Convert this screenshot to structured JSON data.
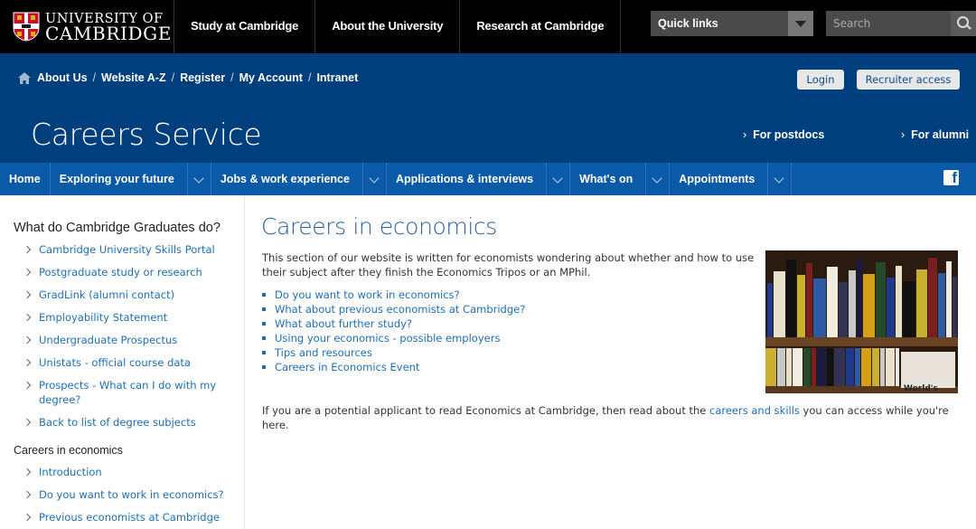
{
  "brand": {
    "line1": "UNIVERSITY OF",
    "line2": "CAMBRIDGE"
  },
  "topnav": [
    {
      "label": "Study at Cambridge"
    },
    {
      "label": "About the University"
    },
    {
      "label": "Research at Cambridge"
    }
  ],
  "quick_links": {
    "label": "Quick links"
  },
  "search": {
    "placeholder": "Search"
  },
  "breadcrumb": [
    {
      "label": "About Us"
    },
    {
      "label": "Website A-Z"
    },
    {
      "label": "Register"
    },
    {
      "label": "My Account"
    },
    {
      "label": "Intranet"
    }
  ],
  "header_buttons": {
    "login": "Login",
    "recruiter": "Recruiter access"
  },
  "site_title": "Careers Service",
  "header_links": {
    "postdocs": "For postdocs",
    "alumni": "For alumni"
  },
  "mainnav": [
    {
      "label": "Home",
      "dropdown": false
    },
    {
      "label": "Exploring your future",
      "dropdown": true
    },
    {
      "label": "Jobs & work experience",
      "dropdown": true
    },
    {
      "label": "Applications & interviews",
      "dropdown": true
    },
    {
      "label": "What's on",
      "dropdown": true
    },
    {
      "label": "Appointments",
      "dropdown": true
    }
  ],
  "sidebar": {
    "title": "What do Cambridge Graduates do?",
    "items": [
      {
        "label": "Cambridge University Skills Portal"
      },
      {
        "label": "Postgraduate study or research"
      },
      {
        "label": "GradLink (alumni contact)"
      },
      {
        "label": "Employability Statement"
      },
      {
        "label": "Undergraduate Prospectus"
      },
      {
        "label": "Unistats - official course data"
      },
      {
        "label": "Prospects - What can I do with my degree?"
      },
      {
        "label": "Back to list of degree subjects"
      }
    ],
    "subtitle": "Careers in economics",
    "subitems": [
      {
        "label": "Introduction"
      },
      {
        "label": "Do you want to work in economics?"
      },
      {
        "label": "Previous economists at Cambridge"
      }
    ]
  },
  "main": {
    "title": "Careers in economics",
    "intro": "This section of our website is written for economists wondering about whether and how to use their subject after they finish the Economics Tripos or an MPhil.",
    "links": [
      {
        "label": "Do you want to work in economics?"
      },
      {
        "label": "What about previous economists at Cambridge?"
      },
      {
        "label": "What about further study?"
      },
      {
        "label": "Using your economics - possible employers"
      },
      {
        "label": "Tips and resources"
      },
      {
        "label": "Careers in Economics Event"
      }
    ],
    "outro_before": "If you are a potential applicant to read Economics at Cambridge, then read about the ",
    "outro_link": "careers and skills",
    "outro_after": " you can access while you're here.",
    "photo_book_title": "World's"
  },
  "colors": {
    "top_bar": "#000000",
    "header_blue": "#003f7d",
    "nav_blue": "#0a5aa8",
    "link_blue": "#1d6fb8"
  }
}
